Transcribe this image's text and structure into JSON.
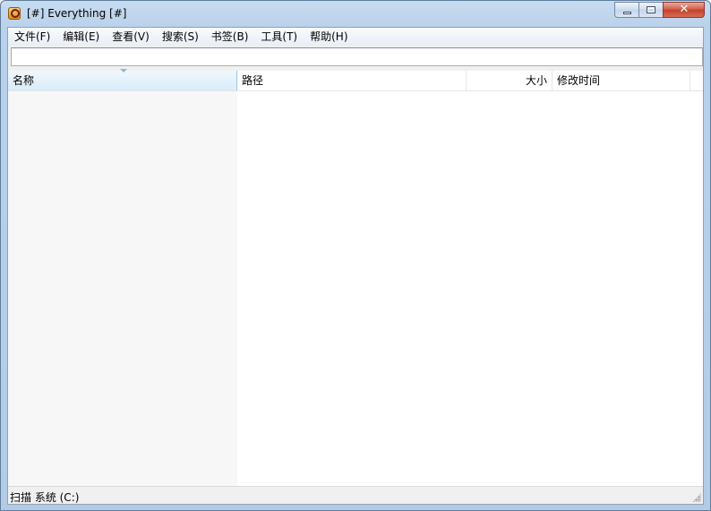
{
  "window": {
    "title": "[#] Everything [#]",
    "icon": "everything-app-icon"
  },
  "caption_buttons": {
    "minimize": "minimize-icon",
    "maximize": "maximize-icon",
    "close": "close-icon",
    "close_glyph": "✕"
  },
  "menu": {
    "items": [
      {
        "label": "文件(F)"
      },
      {
        "label": "编辑(E)"
      },
      {
        "label": "查看(V)"
      },
      {
        "label": "搜索(S)"
      },
      {
        "label": "书签(B)"
      },
      {
        "label": "工具(T)"
      },
      {
        "label": "帮助(H)"
      }
    ]
  },
  "search": {
    "value": "",
    "placeholder": ""
  },
  "list": {
    "columns": [
      {
        "label": "名称",
        "sorted": true
      },
      {
        "label": "路径"
      },
      {
        "label": "大小"
      },
      {
        "label": "修改时间"
      }
    ],
    "rows": []
  },
  "status": {
    "text": "扫描 系统 (C:)"
  },
  "colors": {
    "title_bar": "#b9d1ea",
    "close_button": "#c2412b",
    "sorted_column_header": "#d8ecf9",
    "name_column_background": "#f7f7f7"
  }
}
